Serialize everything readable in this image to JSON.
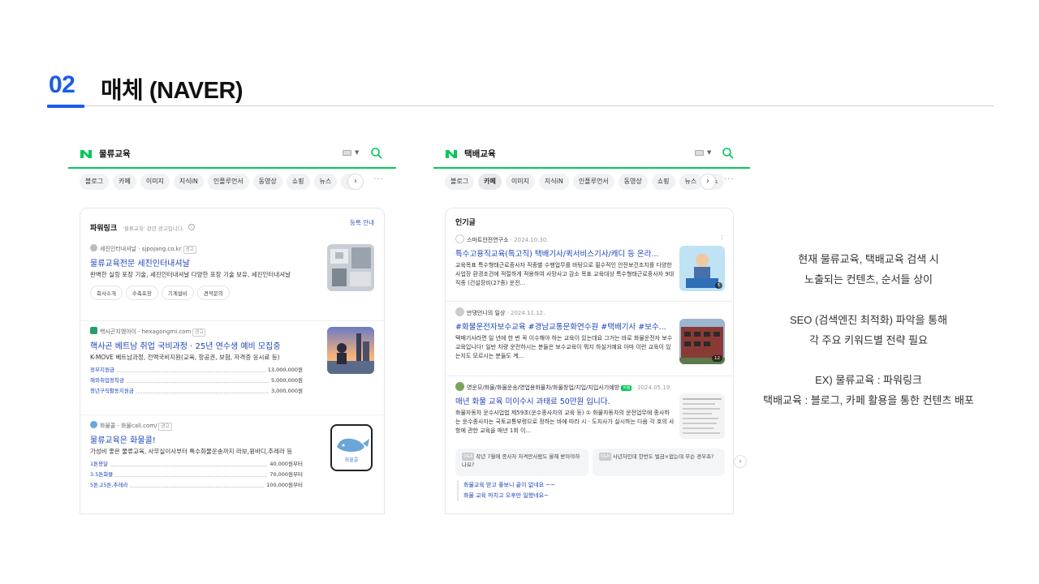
{
  "header": {
    "number": "02",
    "title": "매체 (NAVER)"
  },
  "left_panel": {
    "query": "물류교육",
    "tabs": [
      "블로그",
      "카페",
      "이미지",
      "지식iN",
      "인플루언서",
      "동영상",
      "쇼핑",
      "뉴스",
      "쇼"
    ],
    "powerlink": {
      "title": "파워링크",
      "subtitle": "'물류교육' 관련 광고입니다.",
      "register": "등록 안내",
      "ads": [
        {
          "source": "세진인터내셔날 · sjpojang.co.kr",
          "badge": "광고",
          "title": "물류교육전문 세진인터내셔날",
          "desc": "완벽한 실링 포장 기술, 세진인터내셔날 다양한 포장 기술 보유, 세진인터내셔날",
          "chips": [
            "회사소개",
            "수축포장",
            "기계설비",
            "견적문의"
          ]
        },
        {
          "source": "핵사곤지엠아이 · hexagongmi.com",
          "badge": "광고",
          "title": "핵사곤 베트남 취업 국비과정 · 25년 연수생 예비 모집중",
          "desc": "K-MOVE 베트남과정, 전액국비지원(교육, 항공권, 보험, 자격증 응시료 등)",
          "prices": [
            {
              "label": "정부지원금",
              "amount": "13,000,000원"
            },
            {
              "label": "해외취업정착금",
              "amount": "5,000,000원"
            },
            {
              "label": "청년구직활동지원금",
              "amount": "3,000,000원"
            }
          ]
        },
        {
          "source": "화물콜 · 화물call.com/",
          "badge": "광고",
          "title": "물류교육은 화물콜!",
          "desc": "가성비 좋은 물류교육, 사무실이사부터 특수화물운송까지 라보,윙바디,추레라 등",
          "thumb_label": "화물콜",
          "prices": [
            {
              "label": "1톤용달",
              "amount": "40,000원부터"
            },
            {
              "label": "3.5톤화물",
              "amount": "70,000원부터"
            },
            {
              "label": "5톤,25톤,추레라",
              "amount": "100,000원부터"
            }
          ]
        }
      ]
    }
  },
  "right_panel": {
    "query": "택배교육",
    "tabs": [
      "블로그",
      "카페",
      "이미지",
      "지식iN",
      "인플루언서",
      "동영상",
      "쇼핑",
      "뉴스",
      "쇼"
    ],
    "section_title": "인기글",
    "posts": [
      {
        "source": "스마트안전연구소",
        "date": "· 2024.10.30.",
        "title": "특수고용직교육(특고직) 택배기사/퀵서비스기사/캐디 등 온라...",
        "desc": "교육목표 특수형태근로종사자 직종별 수행업무를 바탕으로 필수적인 안전보건조치를 다양한 사업장 환경조건에 적절하게 적용하여 사망사고 감소 목표 교육대상 특수형태근로종사자 9대 직종 (건설장비(27종) 운전...",
        "thumb_count": "5"
      },
      {
        "source": "만댕언니의 일상",
        "date": "· 2024.11.12.",
        "title": "#화물운전자보수교육 #경남교통문화연수원 #택배기사 #보수...",
        "desc": "택배기사라면 일 년에 한 번 꼭 이수해야 하는 교육이 있는데요 그거는 바로 화물운전자 보수교육입니다! 일반 차량 운전하시는 분들은 보수교육이 뭐지 하실거예요 아마 이런 교육이 있는지도 모르시는 분들도 계...",
        "thumb_count": "12"
      },
      {
        "source": "영운모/화물/화물운송/영업용화물차/화물창업/지입/지입사기예방",
        "date": "· 2024.05.19.",
        "cafe_badge": "카페",
        "title": "매년 화물 교육 미이수시 과태료 50만원 입니다.",
        "desc": "화물자동차 운수사업법 제59조(운수종사자의 교육 등) ① 화물자동차의 운전업무에 종사하는 운수종사자는 국토교통부령으로 정하는 바에 따라 시 · 도지사가 실시하는 다음 각 호의 사항에 관한 교육을 매년 1회 이..."
      }
    ],
    "qa": [
      {
        "tag": "Q&A",
        "text": "작년 7월에 종사자 자격만사람도 올해 받아야하나요?"
      },
      {
        "tag": "Q&A",
        "text": "사년차인데 한번도 벌금×없는데 무슨 경우죠?"
      }
    ],
    "comments": [
      "화물교육 받고 좋보니 끝이 없네요 ~~",
      "화물 교육 마치고 오후만 일했네요~"
    ]
  },
  "description": {
    "line1": "현재 물류교육, 택배교육 검색 시",
    "line2": "노출되는 컨텐츠, 순서들 상이",
    "line3": "SEO (검색엔진 최적화) 파악을 통해",
    "line4": "각 주요 키워드별 전략 필요",
    "line5": "EX) 물류교육 : 파워링크",
    "line6": "택배교육 : 블로그, 카페 활용을 통한 컨텐츠 배포"
  },
  "colors": {
    "accent": "#1a5be8",
    "naver_green": "#03c75a",
    "link_blue": "#1e45b8"
  }
}
